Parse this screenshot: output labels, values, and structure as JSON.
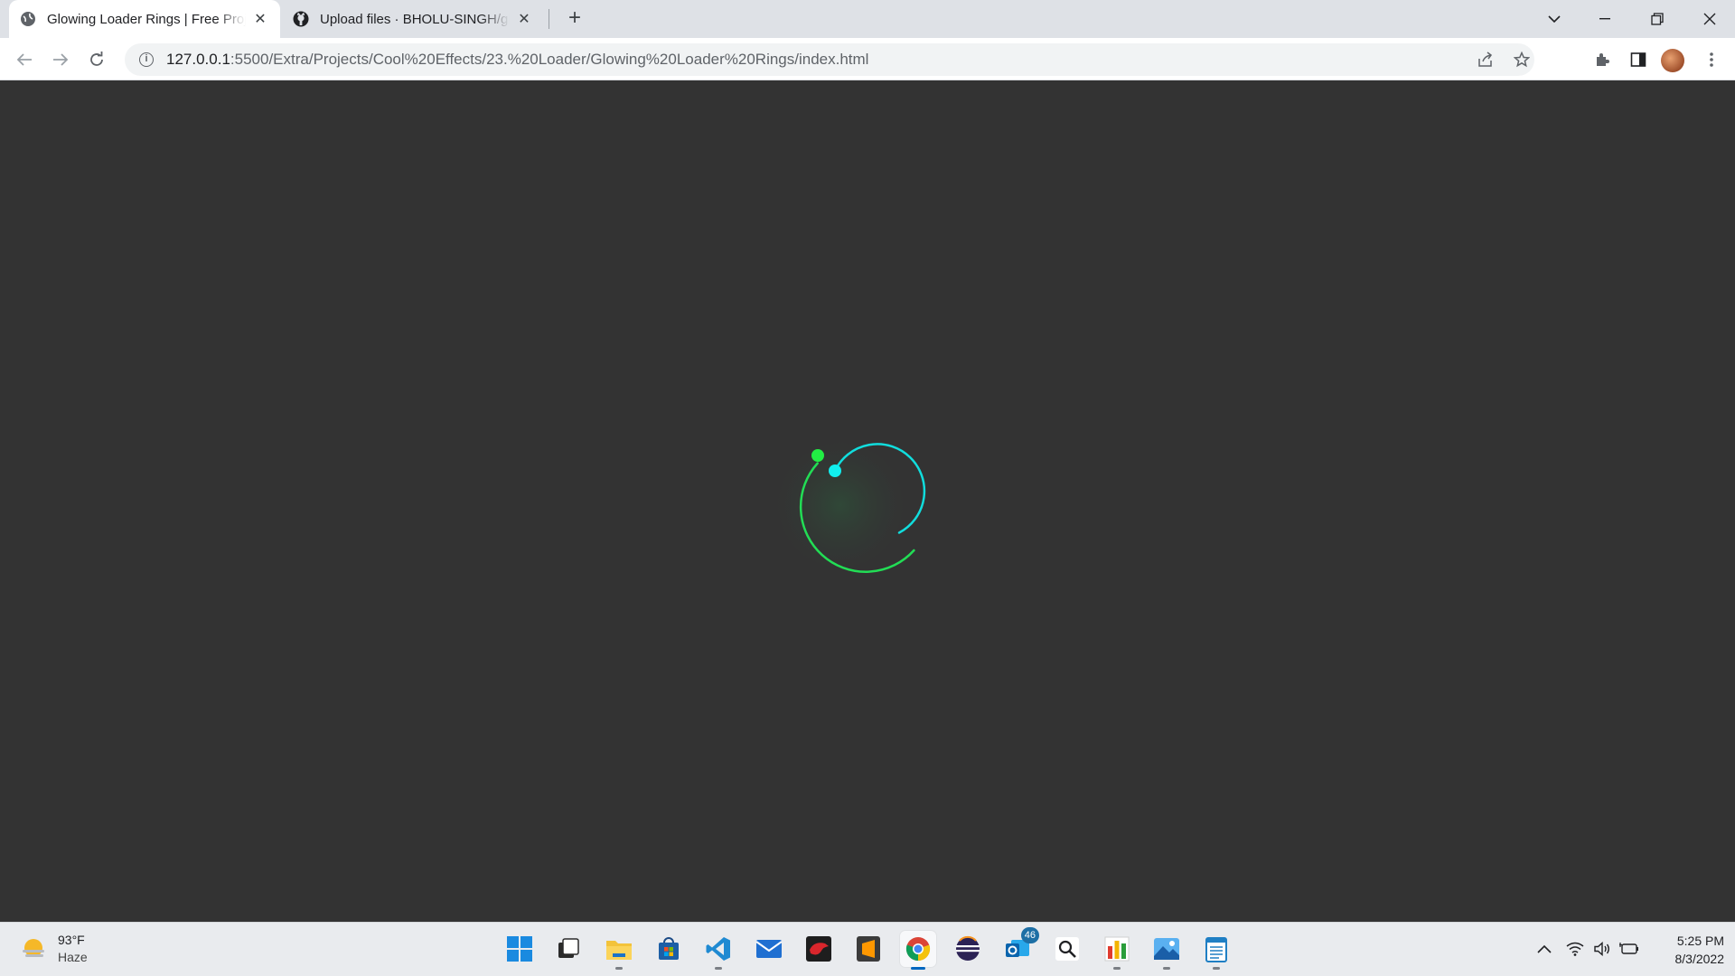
{
  "browser": {
    "tabs": [
      {
        "title": "Glowing Loader Rings | Free Projects",
        "active": true
      },
      {
        "title": "Upload files · BHOLU-SINGH/glowing",
        "active": false
      }
    ],
    "url_host": "127.0.0.1",
    "url_path": ":5500/Extra/Projects/Cool%20Effects/23.%20Loader/Glowing%20Loader%20Rings/index.html"
  },
  "loader": {
    "outer_ring_color": "#22dd55",
    "inner_ring_color": "#11dddd",
    "background": "#333333"
  },
  "taskbar": {
    "weather_temp": "93°F",
    "weather_condition": "Haze",
    "mail_badge": "46",
    "time": "5:25 PM",
    "date": "8/3/2022"
  }
}
